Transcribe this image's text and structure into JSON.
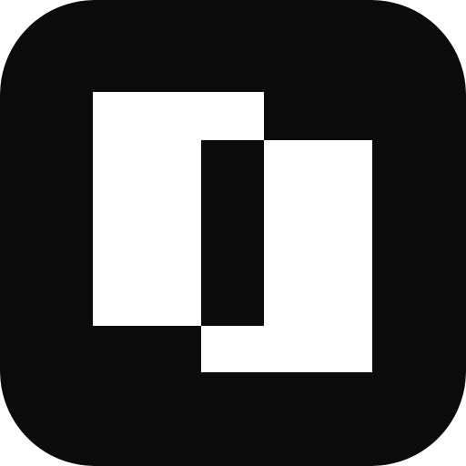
{
  "icon": {
    "name": "overlapping-rectangles-app-icon",
    "colors": {
      "background": "#0b0b0c",
      "foreground": "#ffffff"
    }
  }
}
